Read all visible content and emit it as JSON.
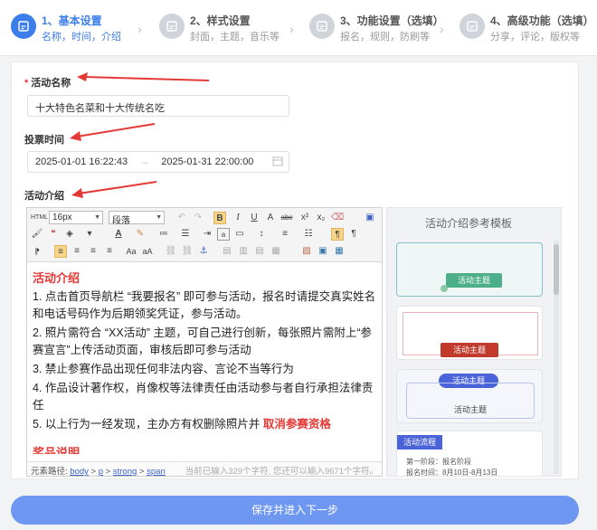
{
  "steps": [
    {
      "num_title": "1、基本设置",
      "sub": "名称，时间，介绍"
    },
    {
      "num_title": "2、样式设置",
      "sub": "封面，主题，音乐等"
    },
    {
      "num_title": "3、功能设置（选填）",
      "sub": "报名，规则，防刷等"
    },
    {
      "num_title": "4、高级功能（选填）",
      "sub": "分享，评论，版权等"
    }
  ],
  "form": {
    "name_label": "活动名称",
    "name_value": "十大特色名菜和十大传统名吃",
    "vote_time_label": "投票时间",
    "start_time": "2025-01-01 16:22:43",
    "time_separator": "→",
    "end_time": "2025-01-31 22:00:00",
    "intro_label": "活动介绍"
  },
  "editor": {
    "font_size": "16px",
    "paragraph": "段落",
    "heading": "活动介绍",
    "items": [
      "1. 点击首页导航栏 “我要报名” 即可参与活动，报名时请提交真实姓名和电话号码作为后期领奖凭证，参与活动。",
      "2. 照片需符合 “XX活动” 主题，可自己进行创新，每张照片需附上“参赛宣言”上传活动页面，审核后即可参与活动",
      "3. 禁止参赛作品出现任何非法内容、言论不当等行为",
      "4. 作品设计著作权，肖像权等法律责任由活动参与者自行承担法律责任"
    ],
    "item5_text": "5. 以上行为一经发现，主办方有权删除照片并 ",
    "item5_highlight": "取消参赛资格",
    "cut_heading": "奖品说明",
    "path_label": "元素路径:",
    "path_body": "body",
    "path_p": "p",
    "path_strong": "strong",
    "path_span": "span",
    "path_sep": ">",
    "char_count": "当前已输入329个字符, 您还可以输入9671个字符。"
  },
  "templates": {
    "title": "活动介绍参考模板",
    "card1_label": "活动主题",
    "card2_label": "活动主题",
    "card3_pill": "活动主题",
    "card3_label": "活动主题",
    "card4_tag": "活动流程",
    "card4_line1": "第一阶段：报名阶段",
    "card4_line2": "报名时间：8月10日-8月13日"
  },
  "save_button": "保存并进入下一步",
  "colors": {
    "accent": "#3b7de9",
    "required": "#e53935",
    "button": "#6d97f0"
  }
}
